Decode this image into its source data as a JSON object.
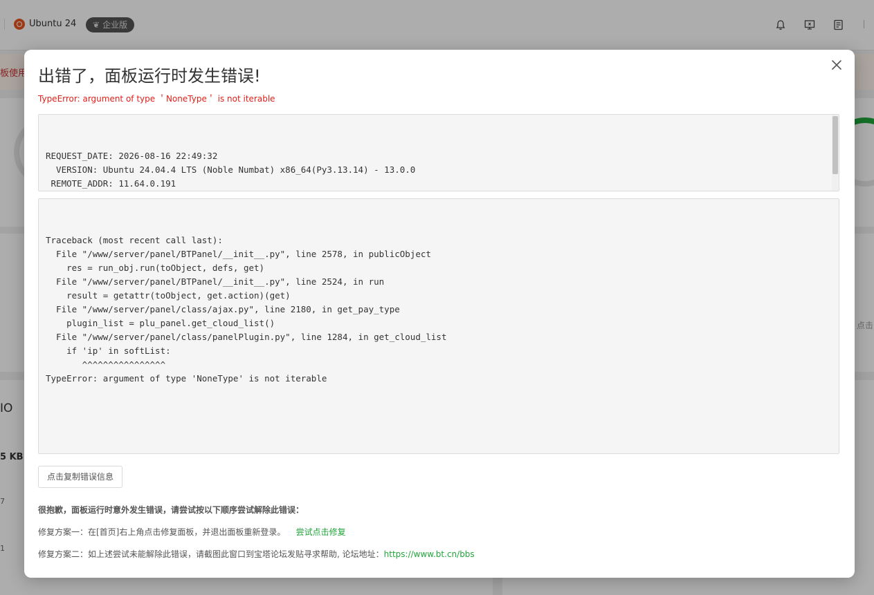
{
  "background": {
    "os_name": "Ubuntu 24",
    "edition": "企业版",
    "notice_fragment": "板使用",
    "side_io": "IO",
    "side_kb": "5 KB",
    "side_num1": "7",
    "side_num2": "1",
    "side_click": "点击",
    "icons": [
      "bell-icon",
      "monitor-icon",
      "notes-icon"
    ]
  },
  "modal": {
    "title": "出错了，面板运行时发生错误!",
    "error_message": "TypeError: argument of type ＇NoneType＇ is not iterable",
    "request_info": "REQUEST_DATE: 2026-08-16 22:49:32\n  VERSION: Ubuntu 24.04.4 LTS (Noble Numbat) x86_64(Py3.13.14) - 13.0.0\n REMOTE_ADDR: 11.64.0.191\n REQUEST_URI: POST /ajax?action=get_pay_type\nREQUEST_FORM: {}",
    "traceback": "Traceback (most recent call last):\n  File \"/www/server/panel/BTPanel/__init__.py\", line 2578, in publicObject\n    res = run_obj.run(toObject, defs, get)\n  File \"/www/server/panel/BTPanel/__init__.py\", line 2524, in run\n    result = getattr(toObject, get.action)(get)\n  File \"/www/server/panel/class/ajax.py\", line 2180, in get_pay_type\n    plugin_list = plu_panel.get_cloud_list()\n  File \"/www/server/panel/class/panelPlugin.py\", line 1284, in get_cloud_list\n    if 'ip' in softList:\n       ^^^^^^^^^^^^^^^^\nTypeError: argument of type 'NoneType' is not iterable",
    "copy_button": "点击复制错误信息",
    "help_title": "很抱歉，面板运行时意外发生错误，请尝试按以下顺序尝试解除此错误：",
    "fix1_text": "修复方案一：在[首页]右上角点击修复面板，并退出面板重新登录。",
    "fix1_link": "尝试点击修复",
    "fix2_text": "修复方案二：如上述尝试未能解除此错误，请截图此窗口到宝塔论坛发贴寻求帮助, 论坛地址：",
    "fix2_link": "https://www.bt.cn/bbs"
  },
  "colors": {
    "error": "#e0201a",
    "link": "#20a53a"
  }
}
